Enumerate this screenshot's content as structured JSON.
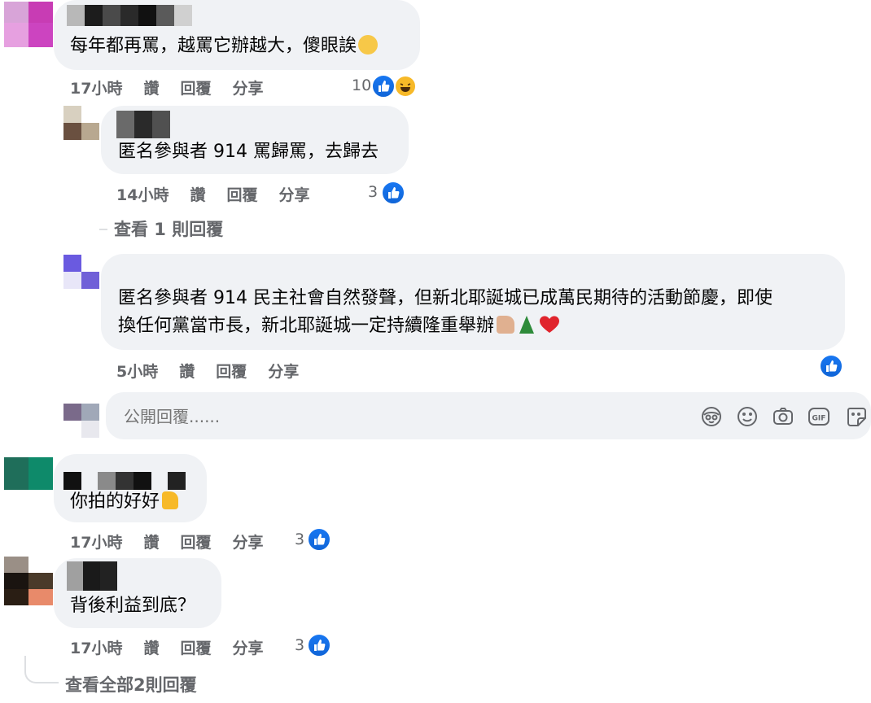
{
  "comments": [
    {
      "text": "每年都再罵，越罵它辦越大，傻眼誒",
      "time": "17小時",
      "like": "讚",
      "reply": "回覆",
      "share": "分享",
      "reactions": "10"
    },
    {
      "text": "匿名參與者 914 罵歸罵，去歸去",
      "time": "14小時",
      "like": "讚",
      "reply": "回覆",
      "share": "分享",
      "reactions": "3"
    },
    {
      "text_line1": "匿名參與者 914 民主社會自然發聲，但新北耶誕城已成萬民期待的活動節慶，即使",
      "text_line2": "換任何黨當市長，新北耶誕城一定持續隆重舉辦",
      "time": "5小時",
      "like": "讚",
      "reply": "回覆",
      "share": "分享"
    },
    {
      "text": "你拍的好好",
      "time": "17小時",
      "like": "讚",
      "reply": "回覆",
      "share": "分享",
      "reactions": "3"
    },
    {
      "text": "背後利益到底？",
      "time": "17小時",
      "like": "讚",
      "reply": "回覆",
      "share": "分享",
      "reactions": "3"
    }
  ],
  "view_replies_1": "查看 1 則回覆",
  "reply_box": {
    "placeholder": "公開回覆......"
  },
  "view_all_replies": "查看全部2則回覆",
  "icons": {
    "avatar_sticker": "avatar-sticker-icon",
    "emoji": "emoji-icon",
    "camera": "camera-icon",
    "gif": "gif-icon",
    "sticker": "sticker-icon"
  },
  "colors": {
    "like_blue": "#1877f2",
    "bubble_bg": "#f0f2f5",
    "meta_gray": "#65676b"
  }
}
